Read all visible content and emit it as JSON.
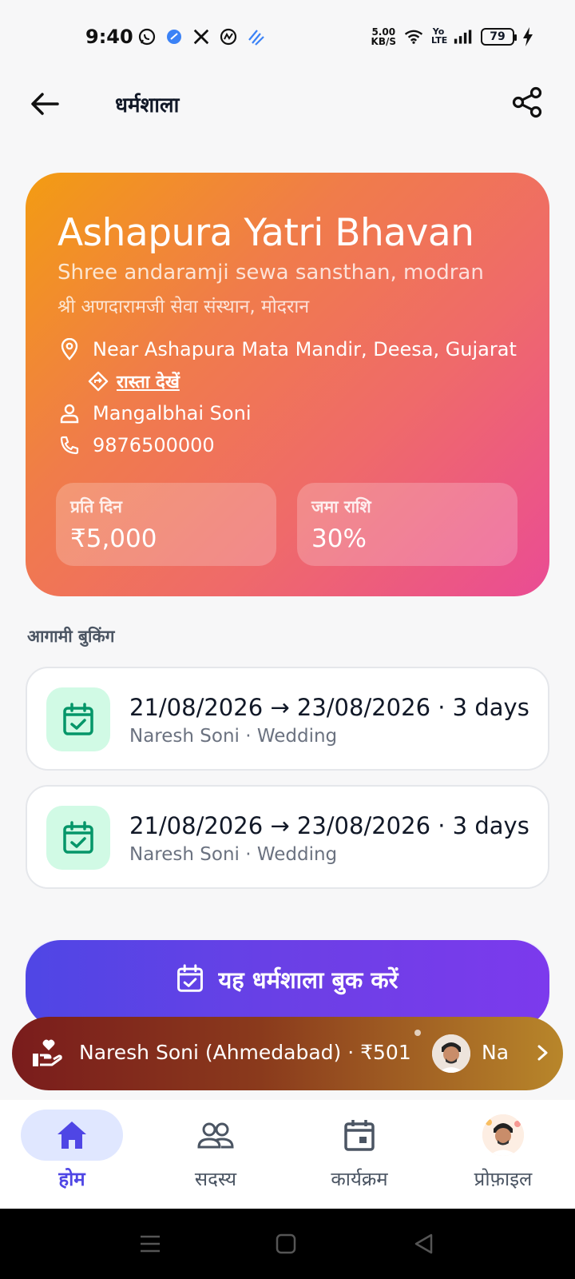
{
  "status_bar": {
    "time": "9:40",
    "speed_top": "5.00",
    "speed_unit": "KB/S",
    "battery": "79",
    "lte": "Yo LTE"
  },
  "app_bar": {
    "title": "धर्मशाला"
  },
  "hero": {
    "name": "Ashapura Yatri Bhavan",
    "trust_en": "Shree andaramji sewa sansthan, modran",
    "trust_hi": "श्री अणदारामजी सेवा संस्थान, मोदरान",
    "address": "Near Ashapura Mata Mandir, Deesa, Gujarat",
    "directions_label": "रास्ता देखें",
    "contact_person": "Mangalbhai Soni",
    "phone": "9876500000",
    "stats": [
      {
        "label": "प्रति दिन",
        "value": "₹5,000"
      },
      {
        "label": "जमा राशि",
        "value": "30%"
      }
    ],
    "colors": {
      "gradient_start": "#f39c12",
      "gradient_end": "#ea4c94"
    }
  },
  "upcoming": {
    "title": "आगामी बुकिंग",
    "bookings": [
      {
        "dates": "21/08/2026 → 23/08/2026 · 3 days",
        "detail": "Naresh Soni · Wedding"
      },
      {
        "dates": "21/08/2026 → 23/08/2026 · 3 days",
        "detail": "Naresh Soni · Wedding"
      }
    ]
  },
  "book_button": {
    "label": "यह धर्मशाला बुक करें"
  },
  "ticker": {
    "text": "Naresh Soni (Ahmedabad) · ₹501",
    "name_preview": "Na"
  },
  "bottom_nav": [
    {
      "label": "होम",
      "icon": "home-icon",
      "active": true
    },
    {
      "label": "सदस्य",
      "icon": "members-icon",
      "active": false
    },
    {
      "label": "कार्यक्रम",
      "icon": "calendar-icon",
      "active": false
    },
    {
      "label": "प्रोफ़ाइल",
      "icon": "profile-avatar",
      "active": false
    }
  ]
}
